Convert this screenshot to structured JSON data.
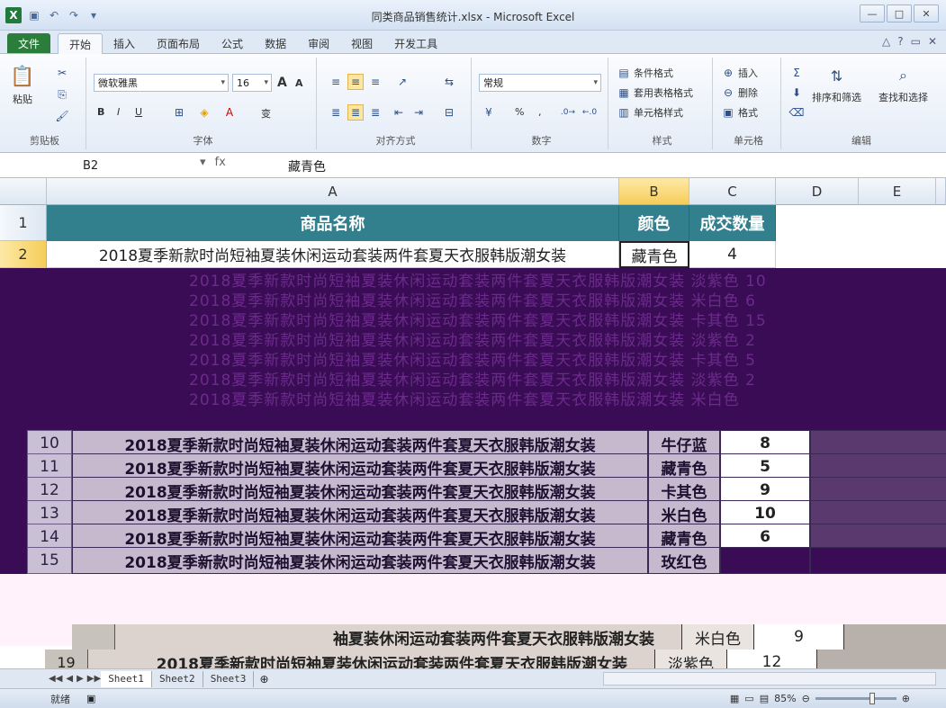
{
  "window": {
    "title": "同类商品销售统计.xlsx - Microsoft Excel"
  },
  "tabs": [
    "开始",
    "插入",
    "页面布局",
    "公式",
    "数据",
    "审阅",
    "视图",
    "开发工具"
  ],
  "file_tab": "文件",
  "ribbon": {
    "clipboard": {
      "label": "剪贴板",
      "paste": "粘贴"
    },
    "font": {
      "label": "字体",
      "name": "微软雅黑",
      "size": "16",
      "bold": "B",
      "italic": "I",
      "underline": "U",
      "grow": "A",
      "shrink": "A",
      "wen": "变"
    },
    "alignment": {
      "label": "对齐方式"
    },
    "number": {
      "label": "数字",
      "format": "常规",
      "percent": "%",
      "comma": ","
    },
    "styles": {
      "label": "样式",
      "cond": "条件格式",
      "table": "套用表格格式",
      "cell": "单元格样式"
    },
    "cells": {
      "label": "单元格",
      "insert": "插入",
      "delete": "删除",
      "format": "格式"
    },
    "editing": {
      "label": "编辑",
      "sort": "排序和筛选",
      "find": "查找和选择"
    }
  },
  "formula_bar": {
    "name_box": "B2",
    "fx": "fx",
    "value": "藏青色"
  },
  "columns": [
    "A",
    "B",
    "C",
    "D",
    "E"
  ],
  "header_row": {
    "a": "商品名称",
    "b": "颜色",
    "c": "成交数量"
  },
  "row2": {
    "num": "1",
    "a": "2018夏季新款时尚短袖夏装休闲运动套装两件套夏天衣服韩版潮女装",
    "b": "藏青色",
    "c": "4",
    "rnum": "2"
  },
  "ghost_rows": [
    {
      "a": "2018夏季新款时尚短袖夏装休闲运动套装两件套夏天衣服韩版潮女装",
      "b": "淡紫色",
      "c": "10"
    },
    {
      "a": "2018夏季新款时尚短袖夏装休闲运动套装两件套夏天衣服韩版潮女装",
      "b": "米白色",
      "c": "6"
    },
    {
      "a": "2018夏季新款时尚短袖夏装休闲运动套装两件套夏天衣服韩版潮女装",
      "b": "卡其色",
      "c": "15"
    },
    {
      "a": "2018夏季新款时尚短袖夏装休闲运动套装两件套夏天衣服韩版潮女装",
      "b": "淡紫色",
      "c": "2"
    },
    {
      "a": "2018夏季新款时尚短袖夏装休闲运动套装两件套夏天衣服韩版潮女装",
      "b": "卡其色",
      "c": "5"
    },
    {
      "a": "2018夏季新款时尚短袖夏装休闲运动套装两件套夏天衣服韩版潮女装",
      "b": "淡紫色",
      "c": "2"
    },
    {
      "a": "2018夏季新款时尚短袖夏装休闲运动套装两件套夏天衣服韩版潮女装",
      "b": "米白色",
      "c": ""
    }
  ],
  "rows": [
    {
      "num": "10",
      "a": "2018夏季新款时尚短袖夏装休闲运动套装两件套夏天衣服韩版潮女装",
      "b": "牛仔蓝",
      "c": "8"
    },
    {
      "num": "11",
      "a": "2018夏季新款时尚短袖夏装休闲运动套装两件套夏天衣服韩版潮女装",
      "b": "藏青色",
      "c": "5"
    },
    {
      "num": "12",
      "a": "2018夏季新款时尚短袖夏装休闲运动套装两件套夏天衣服韩版潮女装",
      "b": "卡其色",
      "c": "9"
    },
    {
      "num": "13",
      "a": "2018夏季新款时尚短袖夏装休闲运动套装两件套夏天衣服韩版潮女装",
      "b": "米白色",
      "c": "10"
    },
    {
      "num": "14",
      "a": "2018夏季新款时尚短袖夏装休闲运动套装两件套夏天衣服韩版潮女装",
      "b": "藏青色",
      "c": "6"
    },
    {
      "num": "15",
      "a": "2018夏季新款时尚短袖夏装休闲运动套装两件套夏天衣服韩版潮女装",
      "b": "玫红色",
      "c": ""
    }
  ],
  "bottom_rows": [
    {
      "num": "",
      "a": "袖夏装休闲运动套装两件套夏天衣服韩版潮女装",
      "b": "米白色",
      "c": "9"
    },
    {
      "num": "19",
      "a": "2018夏季新款时尚短袖夏装休闲运动套装两件套夏天衣服韩版潮女装",
      "b": "淡紫色",
      "c": "12"
    }
  ],
  "sheet_tabs": [
    "Sheet1",
    "Sheet2",
    "Sheet3"
  ],
  "status": {
    "ready": "就绪",
    "zoom": "85%"
  },
  "colors": {
    "header_fill": "#327f8d",
    "glitch": "#3a0c55",
    "file_tab": "#2a7d3a"
  }
}
